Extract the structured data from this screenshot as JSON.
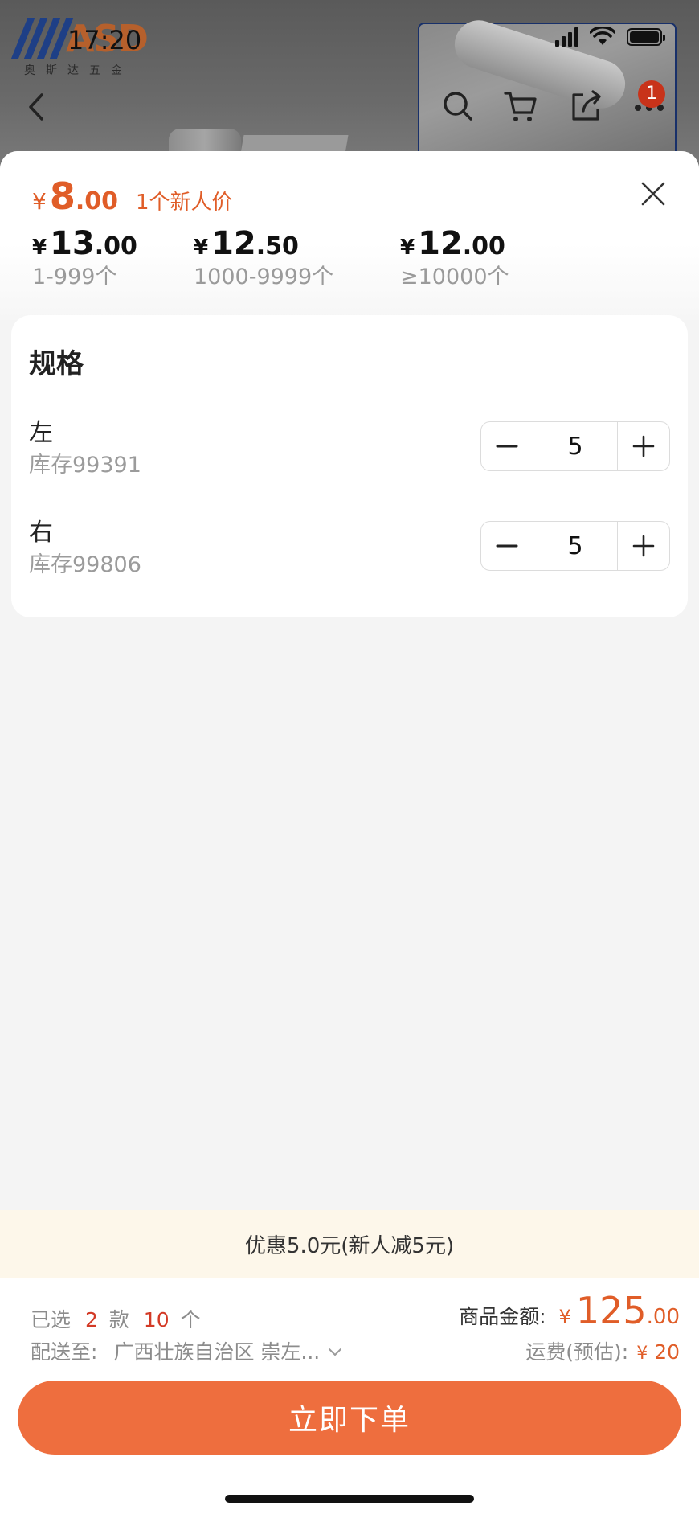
{
  "status_bar": {
    "time": "17:20"
  },
  "background": {
    "logo_mark": "ASD",
    "logo_cn": "奥斯达五金"
  },
  "nav": {
    "badge_count": "1",
    "icons": [
      "back-icon",
      "search-icon",
      "cart-icon",
      "share-icon",
      "more-icon"
    ]
  },
  "price": {
    "new_user": {
      "currency": "¥",
      "int": "8",
      "dec": ".00",
      "label": "1个新人价"
    },
    "tiers": [
      {
        "currency": "¥",
        "int": "13",
        "dec": ".00",
        "range": "1-999个"
      },
      {
        "currency": "¥",
        "int": "12",
        "dec": ".50",
        "range": "1000-9999个"
      },
      {
        "currency": "¥",
        "int": "12",
        "dec": ".00",
        "range": "≥10000个"
      }
    ]
  },
  "spec": {
    "title": "规格",
    "items": [
      {
        "name": "左",
        "stock": "库存99391",
        "qty": "5"
      },
      {
        "name": "右",
        "stock": "库存99806",
        "qty": "5"
      }
    ]
  },
  "promo": {
    "text": "优惠5.0元(新人减5元)"
  },
  "summary": {
    "selected_prefix": "已选",
    "selected_kinds": "2",
    "kinds_unit": "款",
    "selected_count": "10",
    "count_unit": "个",
    "ship_label": "配送至:",
    "ship_address": "广西壮族自治区 崇左...",
    "amount_label": "商品金额:",
    "amount_currency": "¥",
    "amount_int": "125",
    "amount_dec": ".00",
    "freight_label": "运费(预估):",
    "freight_currency": "¥",
    "freight_value": "20"
  },
  "order_button": {
    "label": "立即下单"
  },
  "colors": {
    "accent": "#ee6e3e",
    "price_red": "#e05d28",
    "promo_bg": "#fdf7ea",
    "badge": "#c8331a"
  }
}
